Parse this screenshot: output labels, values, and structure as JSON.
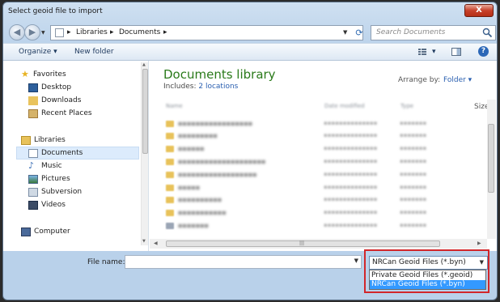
{
  "window": {
    "title": "Select geoid file to import",
    "close_label": "X"
  },
  "address": {
    "crumbs": [
      "Libraries",
      "Documents"
    ],
    "separator": "▸"
  },
  "search": {
    "placeholder": "Search Documents"
  },
  "toolbar": {
    "organize": "Organize ▾",
    "new_folder": "New folder",
    "view": "▾",
    "help": "?"
  },
  "sidebar": {
    "favorites_header": "Favorites",
    "favorites": [
      {
        "label": "Desktop"
      },
      {
        "label": "Downloads"
      },
      {
        "label": "Recent Places"
      }
    ],
    "libraries_header": "Libraries",
    "libraries": [
      {
        "label": "Documents",
        "selected": true
      },
      {
        "label": "Music"
      },
      {
        "label": "Pictures"
      },
      {
        "label": "Subversion"
      },
      {
        "label": "Videos"
      }
    ],
    "computer": "Computer"
  },
  "library": {
    "title": "Documents library",
    "includes_label": "Includes:",
    "includes_link": "2 locations",
    "arrange_label": "Arrange by:",
    "arrange_value": "Folder ▾",
    "col_size": "Size",
    "col_name": "Name",
    "col_date": "Date modified",
    "col_type": "Type"
  },
  "footer": {
    "filename_label": "File name:",
    "filename_value": "",
    "filter_selected": "NRCan Geoid Files (*.byn)",
    "filter_options": [
      {
        "label": "Private Geoid Files (*.geoid)",
        "selected": false
      },
      {
        "label": "NRCan Geoid Files (*.byn)",
        "selected": true
      }
    ]
  }
}
